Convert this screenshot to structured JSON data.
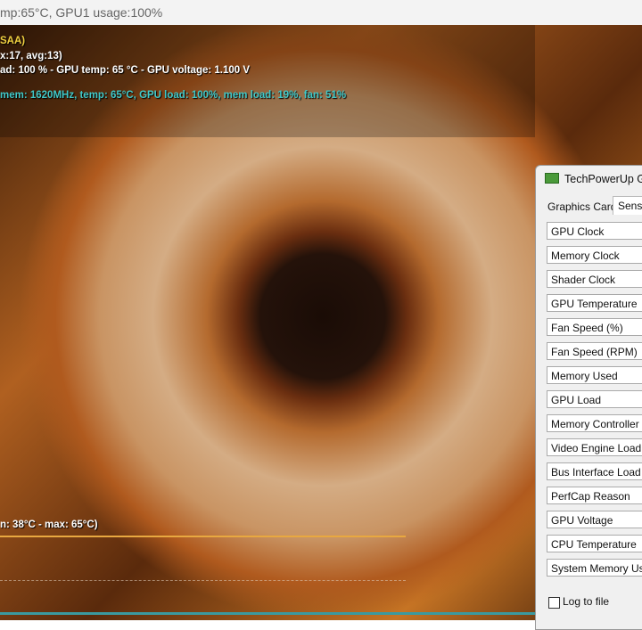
{
  "topbar": {
    "text": "mp:65°C, GPU1 usage:100%"
  },
  "overlay": {
    "line1": "SAA)",
    "line2": "x:17, avg:13)",
    "line3": "ad: 100 % - GPU temp: 65 °C - GPU voltage: 1.100 V",
    "line4": "mem: 1620MHz, temp: 65°C, GPU load: 100%, mem load: 19%, fan: 51%",
    "graph_label": "n: 38°C - max: 65°C)"
  },
  "colors": {
    "yellow": "#f0d040",
    "cyan": "#40c8c8",
    "graph": "#e8a840",
    "teal": "#3a9aa0"
  },
  "gpuz": {
    "title": "TechPowerUp GP",
    "tabs": [
      "Graphics Card",
      "Senso"
    ],
    "sensors": [
      "GPU Clock",
      "Memory Clock",
      "Shader Clock",
      "GPU Temperature",
      "Fan Speed (%)",
      "Fan Speed (RPM)",
      "Memory Used",
      "GPU Load",
      "Memory Controller Loa",
      "Video Engine Load",
      "Bus Interface Load",
      "PerfCap Reason",
      "GPU Voltage",
      "CPU Temperature",
      "System Memory Used"
    ],
    "log_to_file": {
      "label": "Log to file",
      "checked": false
    }
  }
}
